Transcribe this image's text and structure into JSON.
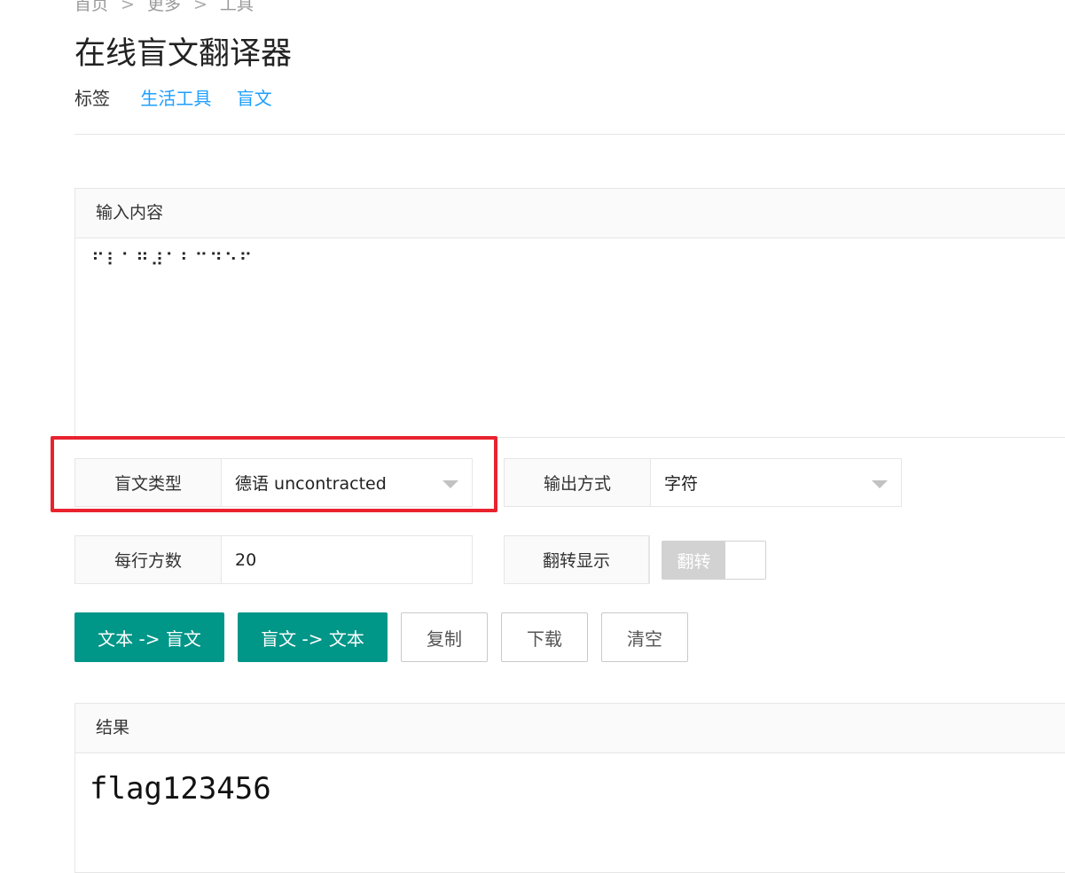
{
  "breadcrumb": {
    "items": [
      "首页",
      "更多",
      "工具"
    ],
    "separator": ">"
  },
  "page_title": "在线盲文翻译器",
  "tags": {
    "label": "标签",
    "items": [
      "生活工具",
      "盲文"
    ]
  },
  "input_panel": {
    "header": "输入内容",
    "value": "⠋⠇⠁⠛⠼⠁⠃⠉⠙⠑⠋"
  },
  "braille_type": {
    "label": "盲文类型",
    "value": "德语 uncontracted"
  },
  "output_mode": {
    "label": "输出方式",
    "value": "字符"
  },
  "cells_per_line": {
    "label": "每行方数",
    "value": "20"
  },
  "flip_display": {
    "label": "翻转显示",
    "toggle_text": "翻转",
    "enabled": false
  },
  "buttons": {
    "text_to_braille": "文本 -> 盲文",
    "braille_to_text": "盲文 -> 文本",
    "copy": "复制",
    "download": "下载",
    "clear": "清空"
  },
  "result_panel": {
    "header": "结果",
    "value": "flag123456"
  },
  "colors": {
    "primary": "#009688",
    "link": "#1e9fff",
    "highlight": "#e8232e"
  }
}
